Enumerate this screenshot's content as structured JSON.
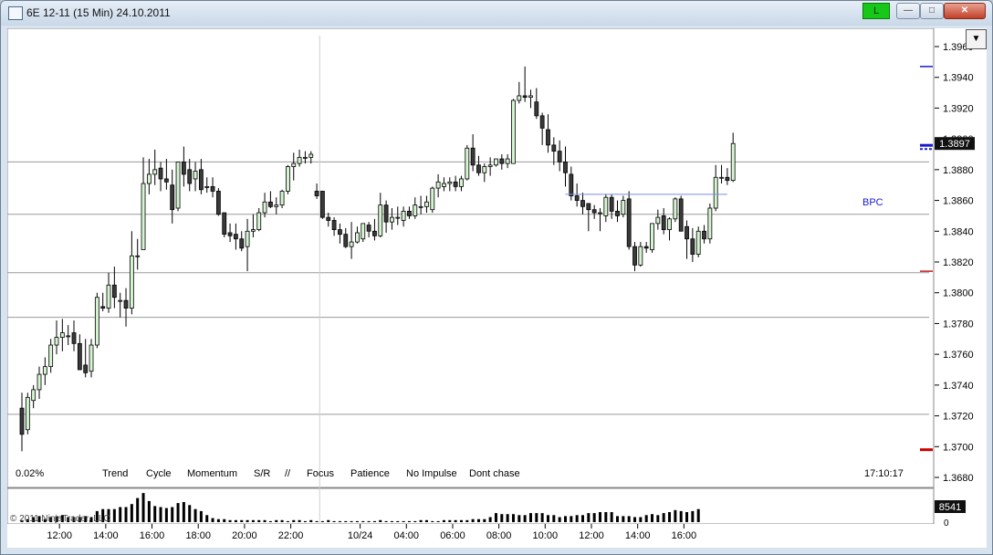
{
  "window": {
    "title": "6E 12-11 (15 Min)  24.10.2011",
    "connection_label": "L",
    "connection_color": "#18c818",
    "buttons": [
      "minimize-icon",
      "maximize-icon",
      "close-icon"
    ]
  },
  "chart_data": {
    "type": "candlestick",
    "y_ticks": [
      "1.3960",
      "1.3940",
      "1.3920",
      "1.3900",
      "1.3880",
      "1.3860",
      "1.3840",
      "1.3820",
      "1.3800",
      "1.3780",
      "1.3760",
      "1.3740",
      "1.3720",
      "1.3700",
      "1.3680"
    ],
    "ylim": [
      1.3675,
      1.3968
    ],
    "x_ticks": [
      {
        "label": "12:00",
        "index": 6.5
      },
      {
        "label": "14:00",
        "index": 14.5
      },
      {
        "label": "16:00",
        "index": 22.5
      },
      {
        "label": "18:00",
        "index": 30.5
      },
      {
        "label": "20:00",
        "index": 38.5
      },
      {
        "label": "22:00",
        "index": 46.5
      },
      {
        "label": "10/24",
        "index": 58.5
      },
      {
        "label": "04:00",
        "index": 66.5
      },
      {
        "label": "06:00",
        "index": 74.5
      },
      {
        "label": "08:00",
        "index": 82.5
      },
      {
        "label": "10:00",
        "index": 90.5
      },
      {
        "label": "12:00",
        "index": 98.5
      },
      {
        "label": "14:00",
        "index": 106.5
      },
      {
        "label": "16:00",
        "index": 114.5
      }
    ],
    "session_break_index": 51.5,
    "horizontal_levels": [
      1.3885,
      1.3851,
      1.3813,
      1.3784,
      1.3721
    ],
    "ohlc": [
      [
        1.3725,
        1.3735,
        1.3697,
        1.3708
      ],
      [
        1.3711,
        1.3735,
        1.3708,
        1.3732
      ],
      [
        1.373,
        1.374,
        1.3725,
        1.3737
      ],
      [
        1.3737,
        1.3752,
        1.3731,
        1.3747
      ],
      [
        1.3747,
        1.3758,
        1.374,
        1.3752
      ],
      [
        1.3752,
        1.377,
        1.3748,
        1.3766
      ],
      [
        1.3766,
        1.3782,
        1.376,
        1.3771
      ],
      [
        1.3771,
        1.3783,
        1.3762,
        1.3774
      ],
      [
        1.3772,
        1.3779,
        1.3766,
        1.3772
      ],
      [
        1.3774,
        1.3782,
        1.3762,
        1.3767
      ],
      [
        1.3767,
        1.3773,
        1.375,
        1.375
      ],
      [
        1.3753,
        1.377,
        1.3745,
        1.3748
      ],
      [
        1.3749,
        1.377,
        1.3745,
        1.3766
      ],
      [
        1.3766,
        1.38,
        1.3764,
        1.3797
      ],
      [
        1.3791,
        1.38,
        1.3788,
        1.379
      ],
      [
        1.379,
        1.3813,
        1.3787,
        1.3805
      ],
      [
        1.3805,
        1.3817,
        1.379,
        1.3797
      ],
      [
        1.3795,
        1.38,
        1.3784,
        1.3795
      ],
      [
        1.3795,
        1.3803,
        1.3778,
        1.379
      ],
      [
        1.379,
        1.384,
        1.3786,
        1.3824
      ],
      [
        1.3824,
        1.3835,
        1.3815,
        1.3824
      ],
      [
        1.3828,
        1.3888,
        1.3828,
        1.3871
      ],
      [
        1.3871,
        1.3887,
        1.3864,
        1.3877
      ],
      [
        1.3877,
        1.3893,
        1.387,
        1.388
      ],
      [
        1.3881,
        1.3885,
        1.3866,
        1.3874
      ],
      [
        1.3874,
        1.3887,
        1.3867,
        1.3872
      ],
      [
        1.387,
        1.388,
        1.3845,
        1.3854
      ],
      [
        1.3855,
        1.3885,
        1.3853,
        1.3885
      ],
      [
        1.3885,
        1.3895,
        1.3869,
        1.3877
      ],
      [
        1.388,
        1.3887,
        1.3866,
        1.3871
      ],
      [
        1.3874,
        1.3885,
        1.3866,
        1.3879
      ],
      [
        1.388,
        1.3887,
        1.3864,
        1.3867
      ],
      [
        1.3869,
        1.3875,
        1.3865,
        1.3869
      ],
      [
        1.3869,
        1.3875,
        1.3862,
        1.3866
      ],
      [
        1.3866,
        1.3868,
        1.385,
        1.3851
      ],
      [
        1.3852,
        1.3852,
        1.3836,
        1.3838
      ],
      [
        1.3839,
        1.3845,
        1.3833,
        1.3837
      ],
      [
        1.3838,
        1.3845,
        1.3828,
        1.3835
      ],
      [
        1.3835,
        1.384,
        1.3827,
        1.3829
      ],
      [
        1.383,
        1.3848,
        1.3814,
        1.384
      ],
      [
        1.384,
        1.3851,
        1.3836,
        1.3841
      ],
      [
        1.3841,
        1.3855,
        1.384,
        1.3852
      ],
      [
        1.3852,
        1.3865,
        1.3849,
        1.3859
      ],
      [
        1.3859,
        1.3866,
        1.3855,
        1.3856
      ],
      [
        1.3856,
        1.3862,
        1.3851,
        1.3857
      ],
      [
        1.3857,
        1.3867,
        1.3855,
        1.3866
      ],
      [
        1.3866,
        1.3883,
        1.3864,
        1.3882
      ],
      [
        1.3882,
        1.3891,
        1.3873,
        1.3884
      ],
      [
        1.3884,
        1.3893,
        1.3882,
        1.3888
      ],
      [
        1.3888,
        1.3892,
        1.3884,
        1.3888
      ],
      [
        1.3888,
        1.3892,
        1.3884,
        1.389
      ],
      [
        1.3866,
        1.3871,
        1.3861,
        1.3863
      ],
      [
        1.3866,
        1.3866,
        1.3848,
        1.3849
      ],
      [
        1.3849,
        1.3852,
        1.3843,
        1.3847
      ],
      [
        1.3847,
        1.3849,
        1.3837,
        1.3841
      ],
      [
        1.3841,
        1.3845,
        1.3832,
        1.3838
      ],
      [
        1.3838,
        1.3842,
        1.3829,
        1.383
      ],
      [
        1.383,
        1.3846,
        1.3822,
        1.3833
      ],
      [
        1.3833,
        1.3843,
        1.3832,
        1.3839
      ],
      [
        1.3835,
        1.3845,
        1.3833,
        1.3845
      ],
      [
        1.3844,
        1.3846,
        1.3836,
        1.384
      ],
      [
        1.384,
        1.3848,
        1.3834,
        1.3837
      ],
      [
        1.3837,
        1.3865,
        1.3836,
        1.3857
      ],
      [
        1.3857,
        1.386,
        1.3839,
        1.3846
      ],
      [
        1.3846,
        1.3855,
        1.3841,
        1.3849
      ],
      [
        1.3849,
        1.3856,
        1.3844,
        1.3849
      ],
      [
        1.3847,
        1.3856,
        1.3843,
        1.3853
      ],
      [
        1.3853,
        1.3856,
        1.3848,
        1.385
      ],
      [
        1.385,
        1.3862,
        1.3848,
        1.3857
      ],
      [
        1.3856,
        1.3863,
        1.3851,
        1.3856
      ],
      [
        1.3856,
        1.3863,
        1.3852,
        1.3859
      ],
      [
        1.3854,
        1.3869,
        1.3852,
        1.3868
      ],
      [
        1.3868,
        1.3877,
        1.3862,
        1.3872
      ],
      [
        1.3869,
        1.3875,
        1.3866,
        1.3871
      ],
      [
        1.3871,
        1.3875,
        1.3866,
        1.3872
      ],
      [
        1.3872,
        1.3876,
        1.3866,
        1.3869
      ],
      [
        1.3869,
        1.3876,
        1.3866,
        1.3874
      ],
      [
        1.3874,
        1.3896,
        1.3873,
        1.3894
      ],
      [
        1.3894,
        1.3903,
        1.3879,
        1.3883
      ],
      [
        1.3883,
        1.3889,
        1.3876,
        1.3878
      ],
      [
        1.3878,
        1.3884,
        1.3872,
        1.3882
      ],
      [
        1.3882,
        1.3888,
        1.3876,
        1.3883
      ],
      [
        1.3883,
        1.3887,
        1.3882,
        1.3887
      ],
      [
        1.3887,
        1.389,
        1.388,
        1.3884
      ],
      [
        1.3884,
        1.389,
        1.3881,
        1.3887
      ],
      [
        1.3884,
        1.3926,
        1.3884,
        1.3925
      ],
      [
        1.3925,
        1.3937,
        1.3923,
        1.3928
      ],
      [
        1.3928,
        1.3947,
        1.3924,
        1.3927
      ],
      [
        1.3927,
        1.3932,
        1.392,
        1.3928
      ],
      [
        1.3924,
        1.3933,
        1.3913,
        1.3915
      ],
      [
        1.3915,
        1.3917,
        1.3896,
        1.3907
      ],
      [
        1.3906,
        1.3916,
        1.3891,
        1.3896
      ],
      [
        1.3896,
        1.3901,
        1.3883,
        1.3892
      ],
      [
        1.3892,
        1.3899,
        1.3879,
        1.3885
      ],
      [
        1.3885,
        1.3895,
        1.3869,
        1.3878
      ],
      [
        1.3877,
        1.3882,
        1.386,
        1.3863
      ],
      [
        1.3863,
        1.3871,
        1.3856,
        1.386
      ],
      [
        1.386,
        1.3865,
        1.3851,
        1.3856
      ],
      [
        1.3858,
        1.3858,
        1.384,
        1.3854
      ],
      [
        1.3854,
        1.3857,
        1.3848,
        1.3852
      ],
      [
        1.3852,
        1.3855,
        1.384,
        1.3852
      ],
      [
        1.385,
        1.3864,
        1.3846,
        1.3862
      ],
      [
        1.3862,
        1.3864,
        1.3848,
        1.3853
      ],
      [
        1.3853,
        1.386,
        1.3846,
        1.385
      ],
      [
        1.3851,
        1.3863,
        1.3849,
        1.386
      ],
      [
        1.3861,
        1.3866,
        1.3828,
        1.383
      ],
      [
        1.383,
        1.3833,
        1.3814,
        1.3818
      ],
      [
        1.3818,
        1.3833,
        1.3817,
        1.383
      ],
      [
        1.383,
        1.3833,
        1.3826,
        1.3829
      ],
      [
        1.3828,
        1.3845,
        1.3826,
        1.3845
      ],
      [
        1.3845,
        1.3854,
        1.3841,
        1.3849
      ],
      [
        1.385,
        1.3855,
        1.3838,
        1.3841
      ],
      [
        1.3841,
        1.3849,
        1.3834,
        1.3848
      ],
      [
        1.3848,
        1.3862,
        1.3846,
        1.3861
      ],
      [
        1.3861,
        1.3863,
        1.384,
        1.384
      ],
      [
        1.3843,
        1.3847,
        1.3822,
        1.3835
      ],
      [
        1.3835,
        1.3842,
        1.382,
        1.3825
      ],
      [
        1.3825,
        1.3843,
        1.3823,
        1.384
      ],
      [
        1.384,
        1.3844,
        1.3832,
        1.3835
      ],
      [
        1.3835,
        1.3858,
        1.3832,
        1.3855
      ],
      [
        1.3855,
        1.3883,
        1.3853,
        1.3875
      ],
      [
        1.3875,
        1.3883,
        1.3871,
        1.3875
      ],
      [
        1.3875,
        1.3881,
        1.387,
        1.3873
      ],
      [
        1.3873,
        1.3904,
        1.3872,
        1.3897
      ]
    ],
    "volume": [
      2,
      3,
      5,
      6,
      3,
      5,
      6,
      7,
      5,
      5,
      5,
      6,
      5,
      11,
      13,
      13,
      13,
      15,
      15,
      18,
      24,
      29,
      21,
      16,
      15,
      14,
      15,
      19,
      20,
      17,
      13,
      11,
      7,
      4,
      3,
      3,
      2,
      2,
      2,
      2,
      2,
      2,
      2,
      1,
      2,
      2,
      1,
      2,
      2,
      1,
      2,
      1,
      1,
      2,
      1,
      1,
      1,
      1,
      1,
      1,
      1,
      1,
      2,
      1,
      1,
      1,
      1,
      1,
      1,
      2,
      2,
      1,
      1,
      2,
      2,
      2,
      2,
      2,
      3,
      3,
      3,
      5,
      9,
      8,
      8,
      8,
      7,
      7,
      9,
      9,
      9,
      7,
      7,
      5,
      6,
      6,
      7,
      7,
      9,
      9,
      10,
      10,
      10,
      6,
      6,
      6,
      5,
      5,
      7,
      8,
      7,
      9,
      10,
      12,
      11,
      10,
      11,
      13
    ],
    "current_price": "1.3897",
    "current_price_y": 1.3897,
    "current_volume": "8541",
    "volume_zero_label": "0",
    "bpc_label": "BPC",
    "bpc_level": 1.3864,
    "bpc_start_index": 94,
    "axis_marks": [
      {
        "price": 1.3947,
        "color": "#1a1acc"
      },
      {
        "price": 1.3814,
        "color": "#cc1a1a"
      },
      {
        "price": 1.3698,
        "color": "#cc0000"
      }
    ],
    "bottom_left_label": "0.02%",
    "indicator_labels": [
      "Trend",
      "Cycle",
      "Momentum",
      "S/R",
      "//",
      "Focus",
      "Patience",
      "No Impulse",
      "Dont chase"
    ],
    "time_label": "17:10:17",
    "copyright": "© 2011 NinjaTrader, LLC",
    "colors": {
      "up": "#d5f5d1",
      "down": "#3a3a3a",
      "grid": "#9a9a9a",
      "bpc": "#1a1acc",
      "price_marker": "#111111"
    }
  }
}
